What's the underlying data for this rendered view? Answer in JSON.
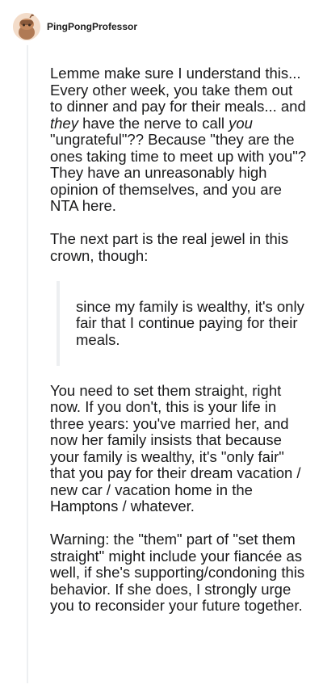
{
  "comment": {
    "username": "PingPongProfessor",
    "avatar_icon": "snoo-avatar-icon",
    "p1": {
      "a": "Lemme make sure I understand this... Every other week, you take them out to dinner and pay for their meals... and ",
      "b": "they",
      "c": " have the nerve to call ",
      "d": "you",
      "e": " \"ungrateful\"?? Because \"they are the ones taking time to meet up with you\"? They have an unreasonably high opinion of themselves, and you are NTA here."
    },
    "p2": "The next part is the real jewel in this crown, though:",
    "quote": "since my family is wealthy, it's only fair that I continue paying for their meals.",
    "p3": "You need to set them straight, right now. If you don't, this is your life in three years: you've married her, and now her family insists that because your family is wealthy, it's \"only fair\" that you pay for their dream vacation / new car / vacation home in the Hamptons / whatever.",
    "p4": "Warning: the \"them\" part of \"set them straight\" might include your fiancée as well, if she's supporting/condoning this behavior. If she does, I strongly urge you to reconsider your future together."
  }
}
